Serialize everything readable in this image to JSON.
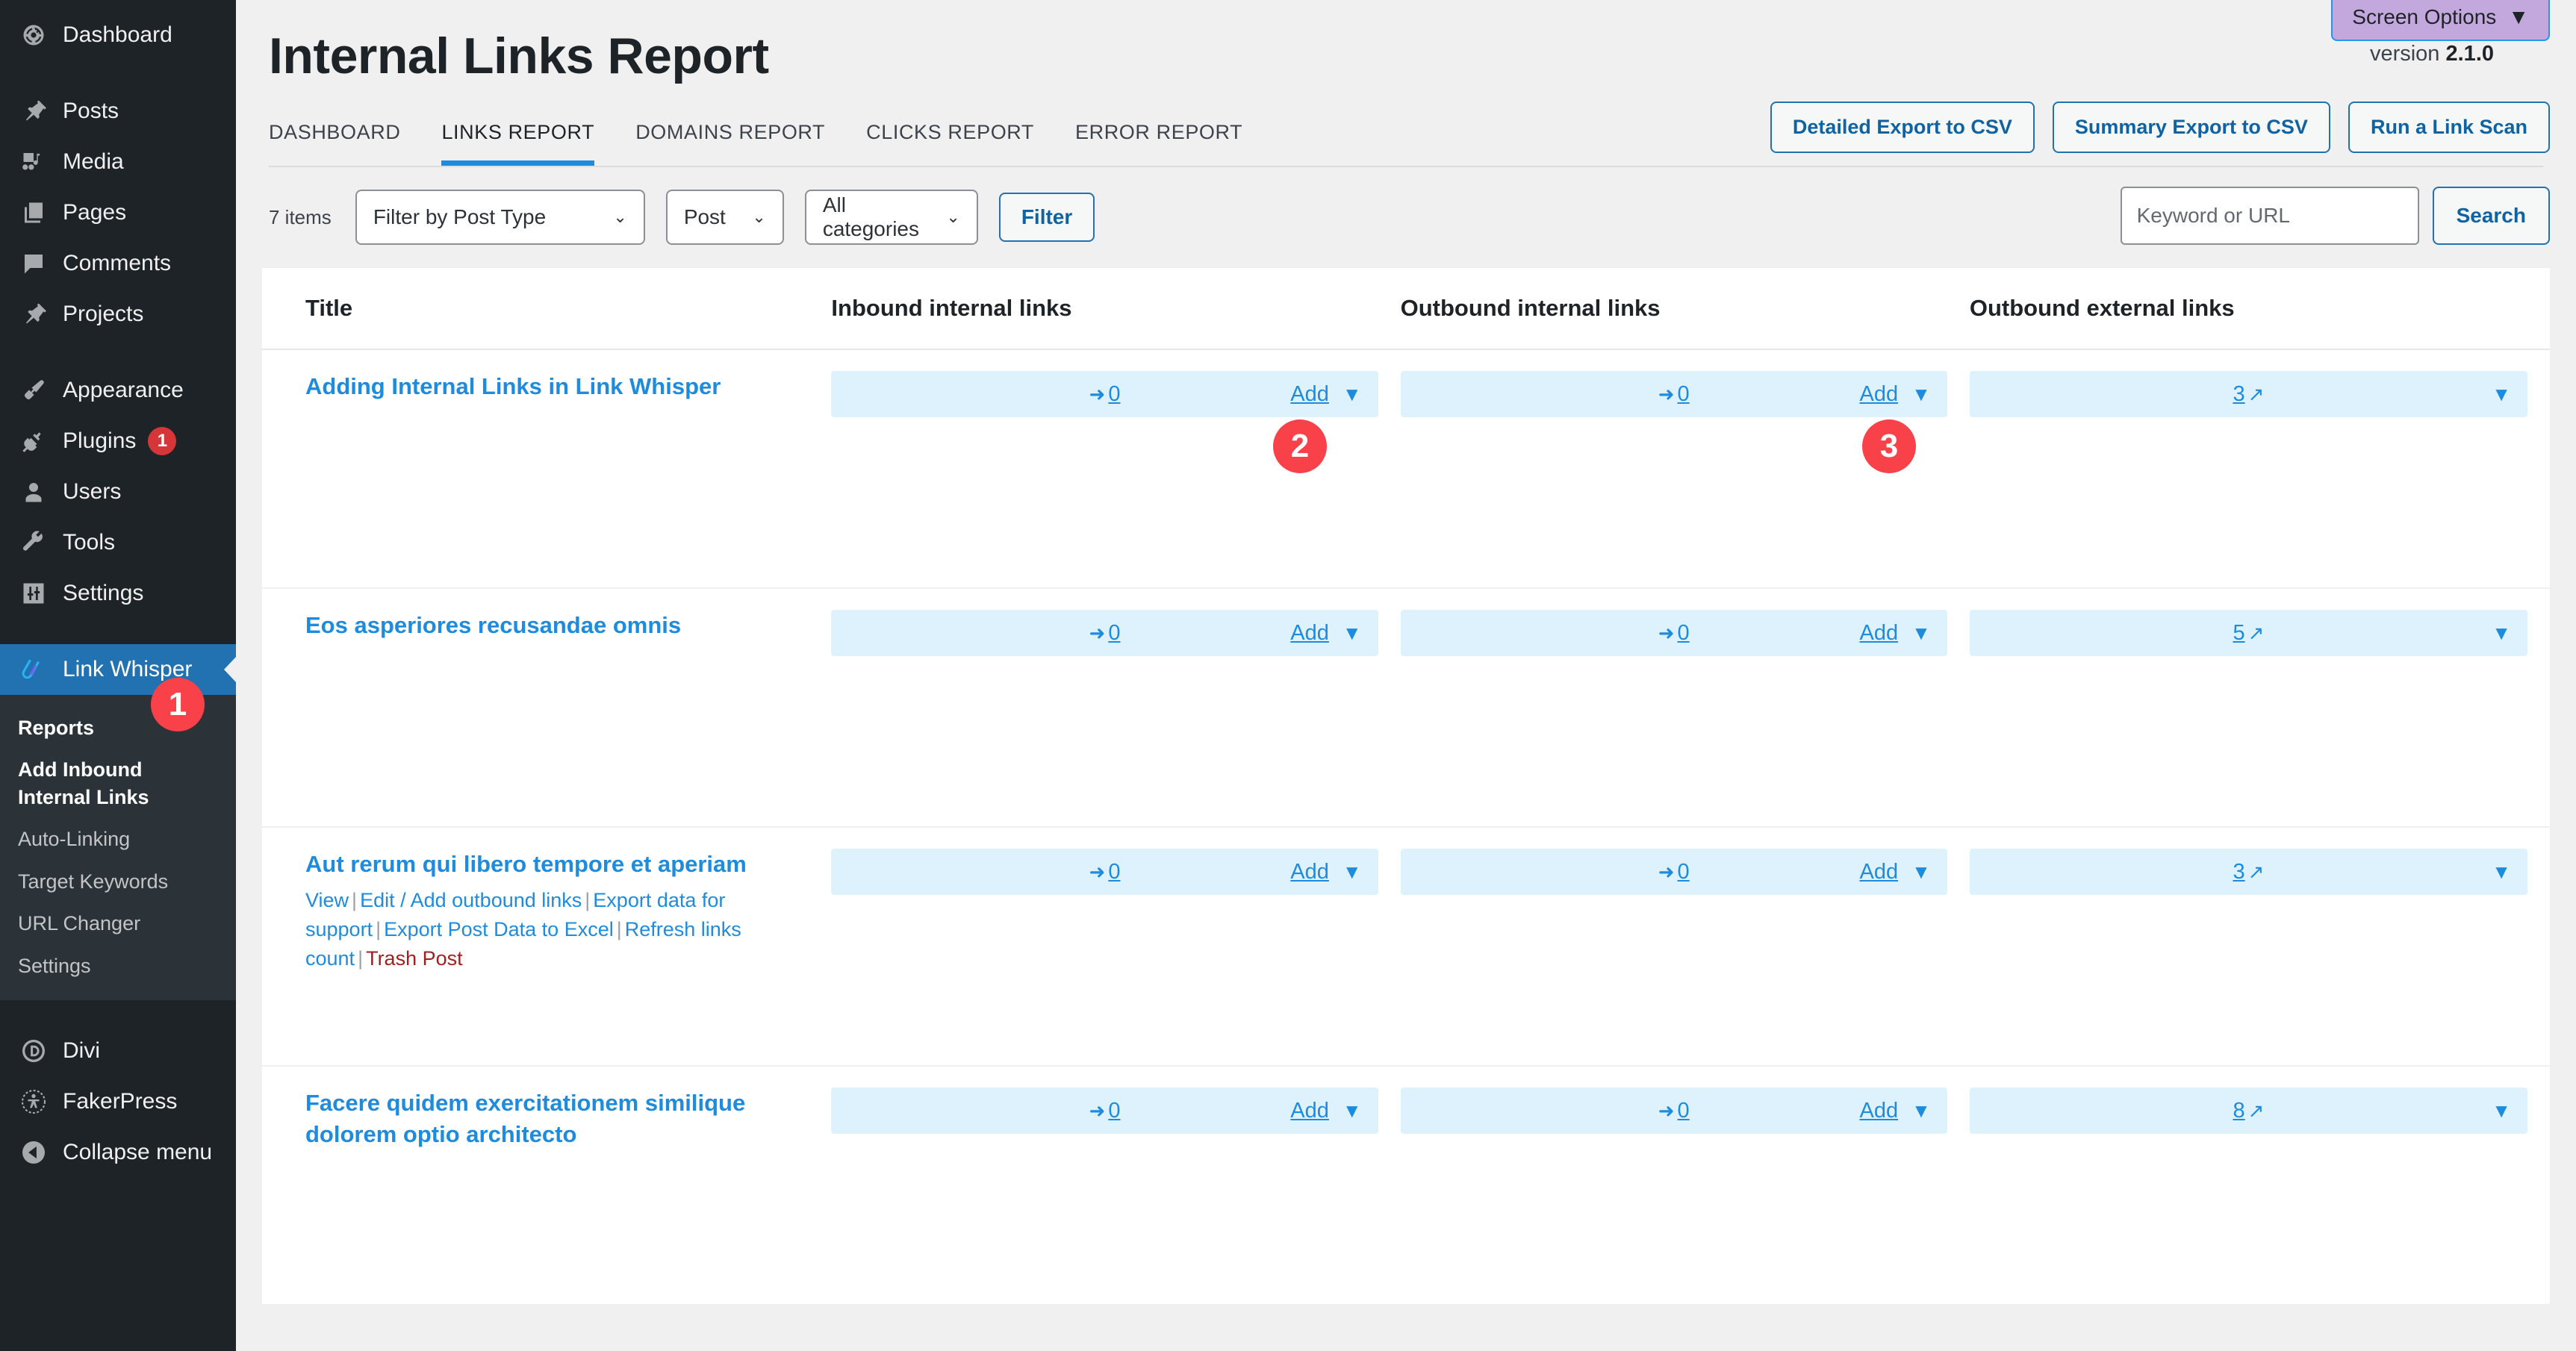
{
  "sidebar": {
    "items": [
      {
        "label": "Dashboard",
        "icon": "dashboard-icon",
        "badge": null
      },
      {
        "label": "Posts",
        "icon": "pin-icon",
        "badge": null
      },
      {
        "label": "Media",
        "icon": "media-icon",
        "badge": null
      },
      {
        "label": "Pages",
        "icon": "pages-icon",
        "badge": null
      },
      {
        "label": "Comments",
        "icon": "comment-icon",
        "badge": null
      },
      {
        "label": "Projects",
        "icon": "pin-icon",
        "badge": null
      },
      {
        "label": "Appearance",
        "icon": "brush-icon",
        "badge": null
      },
      {
        "label": "Plugins",
        "icon": "plug-icon",
        "badge": "1"
      },
      {
        "label": "Users",
        "icon": "user-icon",
        "badge": null
      },
      {
        "label": "Tools",
        "icon": "wrench-icon",
        "badge": null
      },
      {
        "label": "Settings",
        "icon": "sliders-icon",
        "badge": null
      }
    ],
    "active_item": {
      "label": "Link Whisper",
      "icon": "link-whisper-icon"
    },
    "submenu": [
      {
        "label": "Reports",
        "current": true
      },
      {
        "label": "Add Inbound Internal Links",
        "current": true
      },
      {
        "label": "Auto-Linking",
        "current": false
      },
      {
        "label": "Target Keywords",
        "current": false
      },
      {
        "label": "URL Changer",
        "current": false
      },
      {
        "label": "Settings",
        "current": false
      }
    ],
    "bottom_items": [
      {
        "label": "Divi",
        "icon": "divi-icon"
      },
      {
        "label": "FakerPress",
        "icon": "fakerpress-icon"
      },
      {
        "label": "Collapse menu",
        "icon": "collapse-icon"
      }
    ]
  },
  "header": {
    "screen_options_label": "Screen Options",
    "screen_options_caret": "▼",
    "page_title": "Internal Links Report",
    "version_prefix": "version",
    "version_number": "2.1.0"
  },
  "tabs": [
    {
      "label": "Dashboard",
      "active": false
    },
    {
      "label": "Links Report",
      "active": true
    },
    {
      "label": "Domains Report",
      "active": false
    },
    {
      "label": "Clicks Report",
      "active": false
    },
    {
      "label": "Error Report",
      "active": false
    }
  ],
  "top_actions": [
    {
      "label": "Detailed Export to CSV"
    },
    {
      "label": "Summary Export to CSV"
    },
    {
      "label": "Run a Link Scan"
    }
  ],
  "filters": {
    "items_count": "7 items",
    "post_type_select": "Filter by Post Type",
    "post_select": "Post",
    "category_select": "All categories",
    "filter_button": "Filter",
    "chevron": "⌄"
  },
  "search": {
    "placeholder": "Keyword or URL",
    "value": "",
    "button": "Search"
  },
  "table": {
    "columns": [
      "Title",
      "Inbound internal links",
      "Outbound internal links",
      "Outbound external links"
    ],
    "add_label": "Add",
    "caret": "▼",
    "inbound_arrow": "➜",
    "external_arrow": "↗",
    "rows": [
      {
        "title": "Adding Internal Links in Link Whisper",
        "inbound": "0",
        "outbound": "0",
        "external": "3",
        "actions": []
      },
      {
        "title": "Eos asperiores recusandae omnis",
        "inbound": "0",
        "outbound": "0",
        "external": "5",
        "actions": []
      },
      {
        "title": "Aut rerum qui libero tempore et aperiam",
        "inbound": "0",
        "outbound": "0",
        "external": "3",
        "actions": [
          {
            "label": "View",
            "type": "link"
          },
          {
            "label": "Edit / Add outbound links",
            "type": "link"
          },
          {
            "label": "Export data for support",
            "type": "link"
          },
          {
            "label": "Export Post Data to Excel",
            "type": "link"
          },
          {
            "label": "Refresh links count",
            "type": "link"
          },
          {
            "label": "Trash Post",
            "type": "trash"
          }
        ]
      },
      {
        "title": "Facere quidem exercitationem similique dolorem optio architecto",
        "inbound": "0",
        "outbound": "0",
        "external": "8",
        "actions": []
      }
    ]
  },
  "callouts": [
    {
      "number": "1"
    },
    {
      "number": "2"
    },
    {
      "number": "3"
    }
  ],
  "colors": {
    "sidebar_bg": "#1d2327",
    "sidebar_active": "#2271b1",
    "link_blue": "#1e8cde",
    "cell_blue": "#ddf2fd",
    "callout_red": "#f9414a",
    "badge_red": "#d63638",
    "screen_options_bg": "#c3a8dd",
    "trash_red": "#a02020"
  }
}
